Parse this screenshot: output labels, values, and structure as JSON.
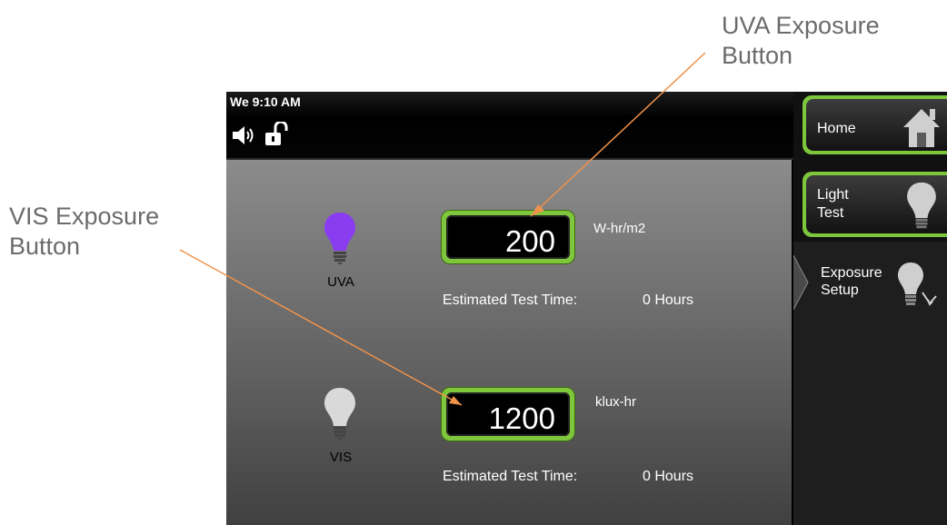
{
  "callouts": {
    "uva": {
      "line1": "UVA Exposure",
      "line2": "Button"
    },
    "vis": {
      "line1": "VIS Exposure",
      "line2": "Button"
    }
  },
  "status_bar": {
    "clock": "We 9:10 AM",
    "icons": [
      "speaker-icon",
      "unlock-icon"
    ]
  },
  "uva": {
    "label": "UVA",
    "bulb_color": "#8a3df0",
    "value": "200",
    "unit": "W-hr/m2",
    "est_label": "Estimated Test Time:",
    "est_value": "0 Hours"
  },
  "vis": {
    "label": "VIS",
    "bulb_color": "#d9d9d9",
    "value": "1200",
    "unit": "klux-hr",
    "est_label": "Estimated Test Time:",
    "est_value": "0 Hours"
  },
  "sidebar": {
    "home": {
      "label": "Home",
      "icon": "home-icon"
    },
    "light_test": {
      "line1": "Light",
      "line2": "Test",
      "icon": "bulb-icon"
    },
    "exposure_setup": {
      "line1": "Exposure",
      "line2": "Setup",
      "icon": "bulb-arrow-icon"
    }
  },
  "colors": {
    "accent_green": "#7ec63c",
    "callout_arrow": "#f0924a",
    "callout_text": "#6b6b6b"
  }
}
